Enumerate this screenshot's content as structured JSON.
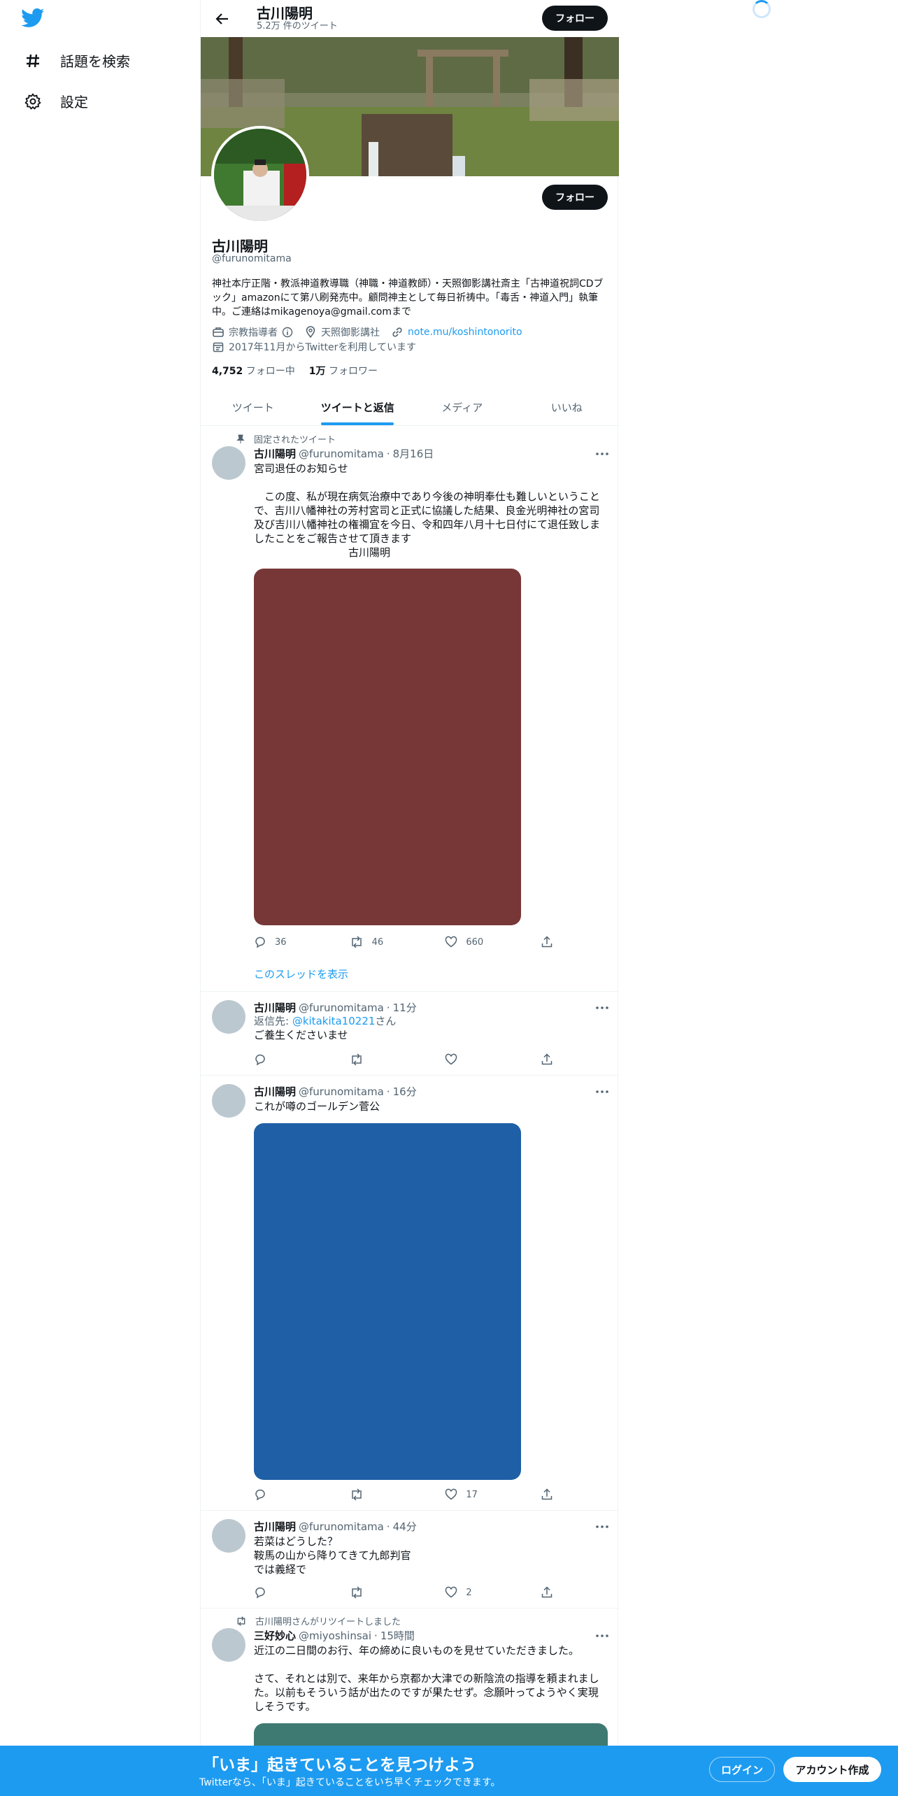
{
  "sidebar": {
    "items": [
      {
        "icon": "hashtag-icon",
        "label": "話題を検索"
      },
      {
        "icon": "gear-icon",
        "label": "設定"
      }
    ]
  },
  "header": {
    "name": "古川陽明",
    "tweet_count": "5.2万 件のツイート",
    "follow_label": "フォロー"
  },
  "profile": {
    "follow_label": "フォロー",
    "name": "古川陽明",
    "handle": "@furunomitama",
    "bio": "神社本庁正階・教派神道教導職（神職・神道教師）・天照御影講社斎主「古神道祝詞CDブック」amazonにて第八刷発売中。顧問神主として毎日祈祷中。「毒舌・神道入門」執筆中。ご連絡はmikagenoya@gmail.comまで",
    "category": "宗教指導者",
    "location": "天照御影講社",
    "url": "note.mu/koshintonorito",
    "joined": "2017年11月からTwitterを利用しています",
    "following_count": "4,752",
    "following_label": "フォロー中",
    "followers_count": "1万",
    "followers_label": "フォロワー"
  },
  "tabs": [
    "ツイート",
    "ツイートと返信",
    "メディア",
    "いいね"
  ],
  "active_tab": "ツイートと返信",
  "tweets": [
    {
      "context": "固定されたツイート",
      "name": "古川陽明",
      "handle": "@furunomitama",
      "time": "8月16日",
      "text": "宮司退任のお知らせ\n\n　この度、私が現在病気治療中であり今後の神明奉仕も難しいということで、吉川八幡神社の芳村宮司と正式に協議した結果、良金光明神社の宮司及び吉川八幡神社の権禰宜を今日、令和四年八月十七日付にて退任致しましたことをご報告させて頂きます\n　　　　　　　　　古川陽明",
      "media_color": "#773737",
      "replies": "36",
      "retweets": "46",
      "likes": "660",
      "thread_link": "このスレッドを表示"
    },
    {
      "name": "古川陽明",
      "handle": "@furunomitama",
      "time": "11分",
      "reply_to_prefix": "返信先: ",
      "reply_to_handle": "@kitakita10221",
      "reply_to_suffix": "さん",
      "text": "ご養生くださいませ"
    },
    {
      "name": "古川陽明",
      "handle": "@furunomitama",
      "time": "16分",
      "text": "これが噂のゴールデン菅公",
      "media_color": "#1f5fa6",
      "likes": "17"
    },
    {
      "name": "古川陽明",
      "handle": "@furunomitama",
      "time": "44分",
      "text": "若菜はどうした？\n鞍馬の山から降りてきて九郎判官\nでは義経で",
      "likes": "2"
    },
    {
      "context": "古川陽明さんがリツイートしました",
      "name": "三好妙心",
      "handle": "@miyoshinsai",
      "time": "15時間",
      "text": "近江の二日間のお行、年の締めに良いものを見せていただきました。\n\nさて、それとは別で、来年から京都か大津での新陰流の指導を頼まれました。以前もそういう話が出たのですが果たせず。念願叶ってようやく実現しそうです。",
      "media_color": "#3f7a72"
    }
  ],
  "bottom_bar": {
    "title": "「いま」起きていることを見つけよう",
    "subtitle": "Twitterなら、「いま」起きていることをいち早くチェックできます。",
    "login": "ログイン",
    "signup": "アカウント作成"
  },
  "colors": {
    "accent": "#1d9bf0",
    "text": "#0f1419",
    "muted": "#536471"
  }
}
